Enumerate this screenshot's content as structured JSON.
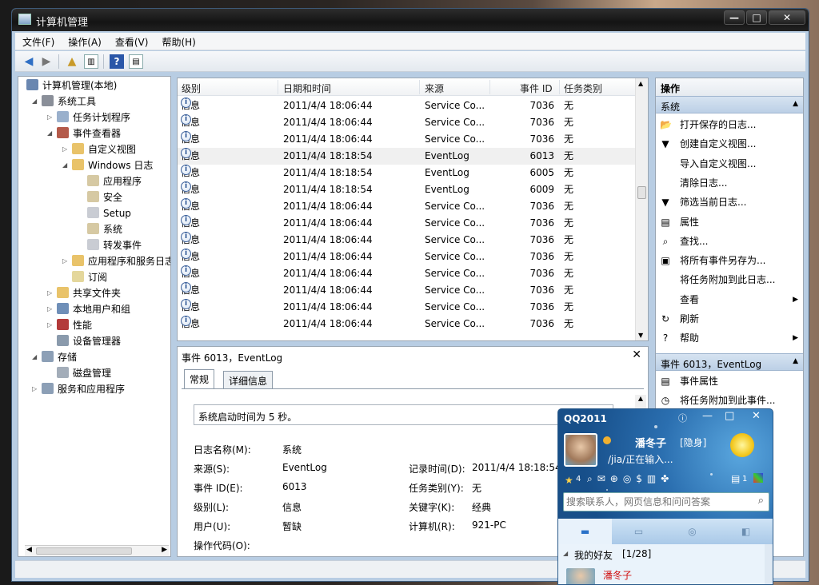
{
  "window": {
    "title": "计算机管理"
  },
  "menu": [
    "文件(F)",
    "操作(A)",
    "查看(V)",
    "帮助(H)"
  ],
  "tree": [
    {
      "label": "计算机管理(本地)",
      "level": 0,
      "expander": "",
      "icon": "computer-icon",
      "color": "#6a87b0"
    },
    {
      "label": "系统工具",
      "level": 1,
      "expander": "◢",
      "icon": "tools-icon",
      "color": "#8a8f99"
    },
    {
      "label": "任务计划程序",
      "level": 2,
      "expander": "▷",
      "icon": "clock-icon",
      "color": "#9ab0cc"
    },
    {
      "label": "事件查看器",
      "level": 2,
      "expander": "◢",
      "icon": "event-viewer-icon",
      "color": "#b45a4a"
    },
    {
      "label": "自定义视图",
      "level": 3,
      "expander": "▷",
      "icon": "folder-icon",
      "color": "#e9c36a"
    },
    {
      "label": "Windows 日志",
      "level": 3,
      "expander": "◢",
      "icon": "folder-icon",
      "color": "#e9c36a"
    },
    {
      "label": "应用程序",
      "level": 4,
      "expander": "",
      "icon": "log-icon",
      "color": "#d6c9a3"
    },
    {
      "label": "安全",
      "level": 4,
      "expander": "",
      "icon": "log-icon",
      "color": "#d6c9a3"
    },
    {
      "label": "Setup",
      "level": 4,
      "expander": "",
      "icon": "log-icon",
      "color": "#c9ccd3"
    },
    {
      "label": "系统",
      "level": 4,
      "expander": "",
      "icon": "log-icon",
      "color": "#d6c9a3"
    },
    {
      "label": "转发事件",
      "level": 4,
      "expander": "",
      "icon": "log-icon",
      "color": "#c9ccd3"
    },
    {
      "label": "应用程序和服务日志",
      "level": 3,
      "expander": "▷",
      "icon": "folder-icon",
      "color": "#e9c36a"
    },
    {
      "label": "订阅",
      "level": 3,
      "expander": "",
      "icon": "subscription-icon",
      "color": "#e4d79c"
    },
    {
      "label": "共享文件夹",
      "level": 2,
      "expander": "▷",
      "icon": "shared-folder-icon",
      "color": "#e9c36a"
    },
    {
      "label": "本地用户和组",
      "level": 2,
      "expander": "▷",
      "icon": "users-icon",
      "color": "#6f8fb8"
    },
    {
      "label": "性能",
      "level": 2,
      "expander": "▷",
      "icon": "performance-icon",
      "color": "#b33a3a"
    },
    {
      "label": "设备管理器",
      "level": 2,
      "expander": "",
      "icon": "device-manager-icon",
      "color": "#8a9aac"
    },
    {
      "label": "存储",
      "level": 1,
      "expander": "◢",
      "icon": "storage-icon",
      "color": "#8c9fb6"
    },
    {
      "label": "磁盘管理",
      "level": 2,
      "expander": "",
      "icon": "disk-icon",
      "color": "#a3adb9"
    },
    {
      "label": "服务和应用程序",
      "level": 1,
      "expander": "▷",
      "icon": "services-icon",
      "color": "#8c9fb6"
    }
  ],
  "event_list": {
    "columns": [
      "级别",
      "日期和时间",
      "来源",
      "事件 ID",
      "任务类别"
    ],
    "rows": [
      {
        "level": "信息",
        "datetime": "2011/4/4 18:06:44",
        "source": "Service Co...",
        "id": "7036",
        "category": "无"
      },
      {
        "level": "信息",
        "datetime": "2011/4/4 18:06:44",
        "source": "Service Co...",
        "id": "7036",
        "category": "无"
      },
      {
        "level": "信息",
        "datetime": "2011/4/4 18:06:44",
        "source": "Service Co...",
        "id": "7036",
        "category": "无"
      },
      {
        "level": "信息",
        "datetime": "2011/4/4 18:18:54",
        "source": "EventLog",
        "id": "6013",
        "category": "无"
      },
      {
        "level": "信息",
        "datetime": "2011/4/4 18:18:54",
        "source": "EventLog",
        "id": "6005",
        "category": "无"
      },
      {
        "level": "信息",
        "datetime": "2011/4/4 18:18:54",
        "source": "EventLog",
        "id": "6009",
        "category": "无"
      },
      {
        "level": "信息",
        "datetime": "2011/4/4 18:06:44",
        "source": "Service Co...",
        "id": "7036",
        "category": "无"
      },
      {
        "level": "信息",
        "datetime": "2011/4/4 18:06:44",
        "source": "Service Co...",
        "id": "7036",
        "category": "无"
      },
      {
        "level": "信息",
        "datetime": "2011/4/4 18:06:44",
        "source": "Service Co...",
        "id": "7036",
        "category": "无"
      },
      {
        "level": "信息",
        "datetime": "2011/4/4 18:06:44",
        "source": "Service Co...",
        "id": "7036",
        "category": "无"
      },
      {
        "level": "信息",
        "datetime": "2011/4/4 18:06:44",
        "source": "Service Co...",
        "id": "7036",
        "category": "无"
      },
      {
        "level": "信息",
        "datetime": "2011/4/4 18:06:44",
        "source": "Service Co...",
        "id": "7036",
        "category": "无"
      },
      {
        "level": "信息",
        "datetime": "2011/4/4 18:06:44",
        "source": "Service Co...",
        "id": "7036",
        "category": "无"
      },
      {
        "level": "信息",
        "datetime": "2011/4/4 18:06:44",
        "source": "Service Co...",
        "id": "7036",
        "category": "无"
      }
    ]
  },
  "detail": {
    "title": "事件 6013，EventLog",
    "tabs": [
      "常规",
      "详细信息"
    ],
    "message": "系统启动时间为 5 秒。",
    "fields_left": [
      {
        "k": "日志名称(M):",
        "v": "系统"
      },
      {
        "k": "来源(S):",
        "v": "EventLog"
      },
      {
        "k": "事件 ID(E):",
        "v": "6013"
      },
      {
        "k": "级别(L):",
        "v": "信息"
      },
      {
        "k": "用户(U):",
        "v": "暂缺"
      },
      {
        "k": "操作代码(O):",
        "v": ""
      }
    ],
    "fields_right": [
      {
        "k": "记录时间(D):",
        "v": "2011/4/4 18:18:54"
      },
      {
        "k": "任务类别(Y):",
        "v": "无"
      },
      {
        "k": "关键字(K):",
        "v": "经典"
      },
      {
        "k": "计算机(R):",
        "v": "921-PC"
      }
    ]
  },
  "actions": {
    "header": "操作",
    "section1": "系统",
    "items1": [
      {
        "label": "打开保存的日志...",
        "icon": "open-folder-icon",
        "glyph": "📂",
        "arrow": ""
      },
      {
        "label": "创建自定义视图...",
        "icon": "filter-icon",
        "glyph": "▼",
        "arrow": ""
      },
      {
        "label": "导入自定义视图...",
        "icon": "",
        "glyph": "",
        "arrow": ""
      },
      {
        "label": "清除日志...",
        "icon": "",
        "glyph": "",
        "arrow": ""
      },
      {
        "label": "筛选当前日志...",
        "icon": "filter-icon",
        "glyph": "▼",
        "arrow": ""
      },
      {
        "label": "属性",
        "icon": "properties-icon",
        "glyph": "▤",
        "arrow": ""
      },
      {
        "label": "查找...",
        "icon": "find-icon",
        "glyph": "⌕",
        "arrow": ""
      },
      {
        "label": "将所有事件另存为...",
        "icon": "save-icon",
        "glyph": "▣",
        "arrow": ""
      },
      {
        "label": "将任务附加到此日志...",
        "icon": "",
        "glyph": "",
        "arrow": ""
      },
      {
        "label": "查看",
        "icon": "",
        "glyph": "",
        "arrow": "▶"
      },
      {
        "label": "刷新",
        "icon": "refresh-icon",
        "glyph": "↻",
        "arrow": ""
      },
      {
        "label": "帮助",
        "icon": "help-icon",
        "glyph": "?",
        "arrow": "▶"
      }
    ],
    "section2": "事件 6013，EventLog",
    "items2": [
      {
        "label": "事件属性",
        "icon": "properties-icon",
        "glyph": "▤",
        "arrow": ""
      },
      {
        "label": "将任务附加到此事件...",
        "icon": "task-icon",
        "glyph": "◷",
        "arrow": ""
      }
    ]
  },
  "qq": {
    "title": "QQ2011",
    "nickname": "潘冬子",
    "status": "[隐身]",
    "signature": "/jia/正在输入...",
    "level": "4",
    "mail_count": "1",
    "search_placeholder": "搜索联系人，网页信息和问问答案",
    "group": "我的好友",
    "group_count": "[1/28]",
    "contact_name": "潘冬子"
  }
}
